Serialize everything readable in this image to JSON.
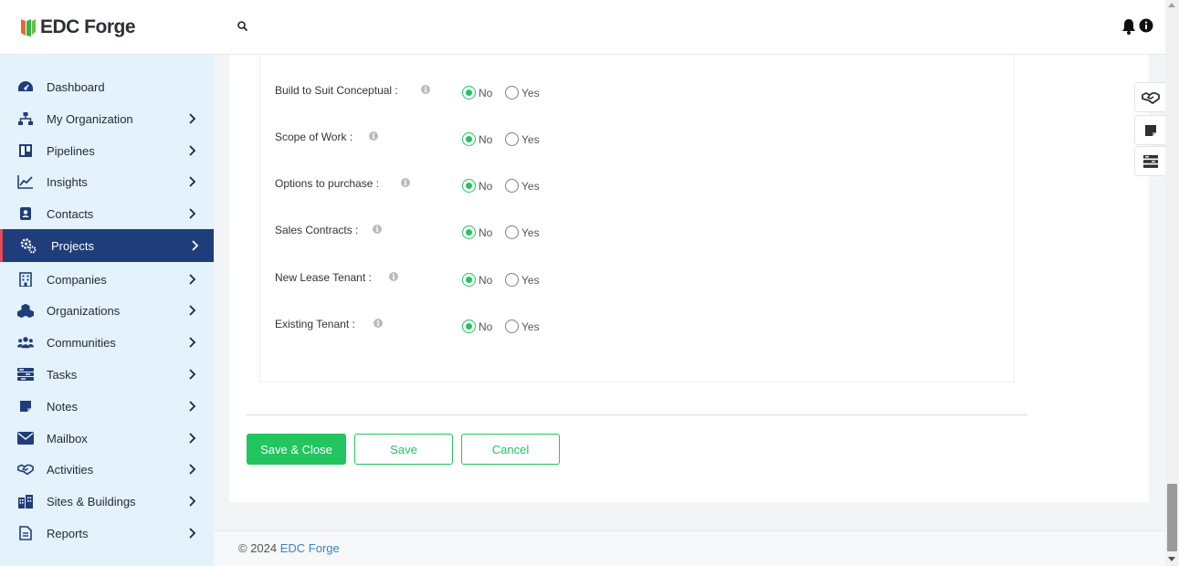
{
  "header": {
    "logo_text": "EDC Forge",
    "search_icon": "search-icon",
    "notification_icon": "bell-icon",
    "info_icon": "info-icon"
  },
  "sidebar": {
    "items": [
      {
        "label": "Dashboard",
        "icon": "dashboard-icon",
        "chevron": false,
        "active": false
      },
      {
        "label": "My Organization",
        "icon": "org-chart-icon",
        "chevron": true,
        "active": false
      },
      {
        "label": "Pipelines",
        "icon": "pipeline-board-icon",
        "chevron": true,
        "active": false
      },
      {
        "label": "Insights",
        "icon": "line-chart-icon",
        "chevron": true,
        "active": false
      },
      {
        "label": "Contacts",
        "icon": "contact-card-icon",
        "chevron": true,
        "active": false
      },
      {
        "label": "Projects",
        "icon": "gears-icon",
        "chevron": true,
        "active": true
      },
      {
        "label": "Companies",
        "icon": "building-icon",
        "chevron": true,
        "active": false
      },
      {
        "label": "Organizations",
        "icon": "cubes-icon",
        "chevron": true,
        "active": false
      },
      {
        "label": "Communities",
        "icon": "users-icon",
        "chevron": true,
        "active": false
      },
      {
        "label": "Tasks",
        "icon": "tasks-icon",
        "chevron": true,
        "active": false
      },
      {
        "label": "Notes",
        "icon": "note-icon",
        "chevron": true,
        "active": false
      },
      {
        "label": "Mailbox",
        "icon": "envelope-icon",
        "chevron": true,
        "active": false
      },
      {
        "label": "Activities",
        "icon": "handshake-icon",
        "chevron": true,
        "active": false
      },
      {
        "label": "Sites & Buildings",
        "icon": "city-icon",
        "chevron": true,
        "active": false
      },
      {
        "label": "Reports",
        "icon": "report-icon",
        "chevron": true,
        "active": false
      }
    ]
  },
  "form": {
    "fields": [
      {
        "label": "Build to Suit Conceptual :",
        "value": "No",
        "options": [
          "No",
          "Yes"
        ]
      },
      {
        "label": "Scope of Work :",
        "value": "No",
        "options": [
          "No",
          "Yes"
        ]
      },
      {
        "label": "Options to purchase :",
        "value": "No",
        "options": [
          "No",
          "Yes"
        ]
      },
      {
        "label": "Sales Contracts :",
        "value": "No",
        "options": [
          "No",
          "Yes"
        ]
      },
      {
        "label": "New Lease Tenant :",
        "value": "No",
        "options": [
          "No",
          "Yes"
        ]
      },
      {
        "label": "Existing Tenant :",
        "value": "No",
        "options": [
          "No",
          "Yes"
        ]
      }
    ],
    "help_glyph": "i"
  },
  "actions": {
    "save_close_label": "Save & Close",
    "save_label": "Save",
    "cancel_label": "Cancel"
  },
  "footer": {
    "copyright": "© 2024 ",
    "brand_link": "EDC Forge"
  },
  "right_toolbar": {
    "tools": [
      "handshake-icon",
      "sticky-note-icon",
      "list-icon"
    ]
  },
  "colors": {
    "accent_green": "#22c55e",
    "sidebar_bg": "#e3f2fb",
    "active_bg": "#1f3d7a",
    "active_marker": "#e14b5a",
    "icon_navy": "#1f3d7a",
    "link_blue": "#3b82c4"
  }
}
